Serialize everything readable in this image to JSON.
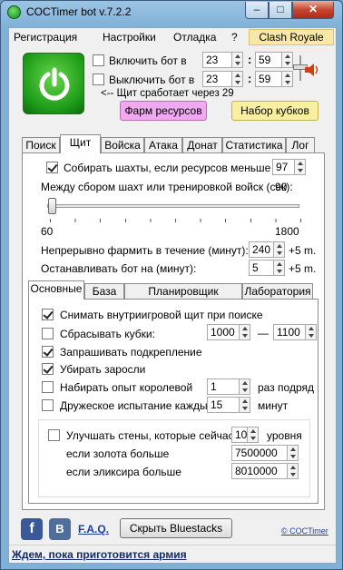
{
  "window": {
    "title": "COCTimer bot v.7.2.2",
    "minimize": "–",
    "maximize": "□",
    "close": "✕"
  },
  "menu": {
    "items": [
      "Регистрация",
      "Настройки",
      "Отладка",
      "?"
    ],
    "clash": "Clash Royale"
  },
  "schedule": {
    "enable_label": "Включить бот в",
    "enable_hour": "23",
    "enable_min": "59",
    "disable_label": "Выключить бот в",
    "disable_hour": "23",
    "disable_min": "59",
    "shield_note": "<-- Щит сработает через 29"
  },
  "buttons": {
    "farm": "Фарм ресурсов",
    "cups": "Набор кубков",
    "bluestacks": "Скрыть Bluestacks"
  },
  "tabs": [
    "Поиск",
    "Щит",
    "Войска",
    "Атака",
    "Донат",
    "Статистика",
    "Лог"
  ],
  "shield": {
    "collect_label": "Собирать шахты, если ресурсов меньше (%):",
    "collect_value": "97",
    "between_label": "Между сбором шахт или тренировкой войск (сек):",
    "between_value": "90",
    "slider_min": "60",
    "slider_max": "1800",
    "slider_fraction": 0.0,
    "farm_label": "Непрерывно фармить в течение (минут):",
    "farm_value": "240",
    "farm_suffix": "+5 m.",
    "stop_label": "Останавливать бот на (минут):",
    "stop_value": "5",
    "stop_suffix": "+5 m."
  },
  "subtabs": [
    "Основные",
    "База",
    "Планировщик построек",
    "Лаборатория"
  ],
  "basic": {
    "remove_shield": "Снимать внутриигровой щит при поиске",
    "drop_cups": "Сбрасывать кубки:",
    "drop_from": "1000",
    "drop_dash": "—",
    "drop_to": "1100",
    "request": "Запрашивать подкрепление",
    "bushes": "Убирать заросли",
    "queen_xp": "Набирать опыт королевой",
    "queen_value": "1",
    "queen_suffix": "раз подряд",
    "friendly": "Дружеское испытание каждые",
    "friendly_value": "15",
    "friendly_suffix": "минут",
    "walls": "Улучшать стены, которые сейчас",
    "walls_value": "10",
    "walls_suffix": "уровня",
    "gold_label": "если золота больше",
    "gold_value": "7500000",
    "elixir_label": "если эликсира больше",
    "elixir_value": "8010000"
  },
  "footer": {
    "fb": "f",
    "vk": "B",
    "faq": "F.A.Q.",
    "copyright": "© COCTimer"
  },
  "status": {
    "text": "Ждем, пока приготовится армия"
  },
  "colors": {
    "accent_green": "#1c9a18",
    "farm_button": "#f0a8f0",
    "cups_button": "#f8f0a0",
    "clash_menu": "#f7e8a8"
  }
}
